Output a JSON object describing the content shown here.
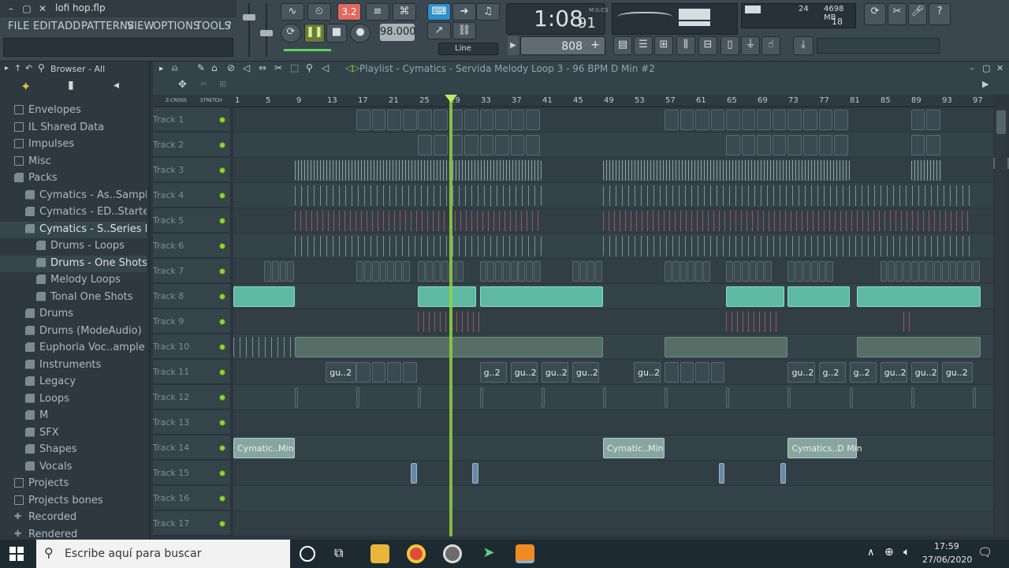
{
  "window": {
    "project": "lofi hop.flp"
  },
  "menu": [
    "FILE",
    "EDIT",
    "ADD",
    "PATTERNS",
    "VIEW",
    "OPTIONS",
    "TOOLS",
    "?"
  ],
  "transport": {
    "time": "1:08",
    "time_sub": "91",
    "time_unit": "M:S:CS",
    "tempo": "98.000",
    "pattern_value": "808",
    "snap": "Line",
    "pattern_mode_label": "3.2"
  },
  "cpu": {
    "voices": "24",
    "memory": "4698 MB",
    "polyphony": "18"
  },
  "browser": {
    "title": "Browser - All",
    "items": [
      {
        "label": "Envelopes",
        "type": "folder",
        "indent": 0
      },
      {
        "label": "IL Shared Data",
        "type": "folder",
        "indent": 0
      },
      {
        "label": "Impulses",
        "type": "folder",
        "indent": 0
      },
      {
        "label": "Misc",
        "type": "folder",
        "indent": 0
      },
      {
        "label": "Packs",
        "type": "pack",
        "indent": 0
      },
      {
        "label": "Cymatics - As..Sample Pack",
        "type": "pack",
        "indent": 1
      },
      {
        "label": "Cymatics - ED..Starter Pack",
        "type": "pack",
        "indent": 1
      },
      {
        "label": "Cymatics - S..Series Pack",
        "type": "pack",
        "indent": 1
      },
      {
        "label": "Drums - Loops",
        "type": "pack",
        "indent": 2
      },
      {
        "label": "Drums - One Shots",
        "type": "pack",
        "indent": 2
      },
      {
        "label": "Melody Loops",
        "type": "pack",
        "indent": 2
      },
      {
        "label": "Tonal One Shots",
        "type": "pack",
        "indent": 2
      },
      {
        "label": "Drums",
        "type": "pack",
        "indent": 1
      },
      {
        "label": "Drums (ModeAudio)",
        "type": "pack",
        "indent": 1
      },
      {
        "label": "Euphoria Voc..ample Pack",
        "type": "pack",
        "indent": 1
      },
      {
        "label": "Instruments",
        "type": "pack",
        "indent": 1
      },
      {
        "label": "Legacy",
        "type": "pack",
        "indent": 1
      },
      {
        "label": "Loops",
        "type": "pack",
        "indent": 1
      },
      {
        "label": "M",
        "type": "pack",
        "indent": 1
      },
      {
        "label": "SFX",
        "type": "pack",
        "indent": 1
      },
      {
        "label": "Shapes",
        "type": "pack",
        "indent": 1
      },
      {
        "label": "Vocals",
        "type": "pack",
        "indent": 1
      },
      {
        "label": "Projects",
        "type": "folder",
        "indent": 0
      },
      {
        "label": "Projects bones",
        "type": "folder",
        "indent": 0
      },
      {
        "label": "Recorded",
        "type": "plus",
        "indent": 0
      },
      {
        "label": "Rendered",
        "type": "plus",
        "indent": 0
      }
    ]
  },
  "playlist": {
    "title": "Playlist - Cymatics - Servida Melody Loop 3 - 96 BPM D Min #2",
    "ruler": [
      "1",
      "5",
      "9",
      "13",
      "17",
      "21",
      "25",
      "29",
      "33",
      "37",
      "41",
      "45",
      "49",
      "53",
      "57",
      "61",
      "65",
      "69",
      "73",
      "77",
      "81",
      "85",
      "89",
      "93",
      "97"
    ],
    "zcross_label": "Z-CROSS",
    "stretch_label": "STRETCH",
    "tracks": [
      "Track 1",
      "Track 2",
      "Track 3",
      "Track 4",
      "Track 5",
      "Track 6",
      "Track 7",
      "Track 8",
      "Track 9",
      "Track 10",
      "Track 11",
      "Track 12",
      "Track 13",
      "Track 14",
      "Track 15",
      "Track 16",
      "Track 17"
    ],
    "clip_labels": {
      "cym1": "Cymatic..Min",
      "cym2": "Cymatic..Min",
      "cym3": "Cymatics..D Min",
      "gu": "gu..2",
      "g2": "g..2"
    }
  },
  "taskbar": {
    "search_placeholder": "Escribe aquí para buscar",
    "time": "17:59",
    "date": "27/06/2020"
  }
}
